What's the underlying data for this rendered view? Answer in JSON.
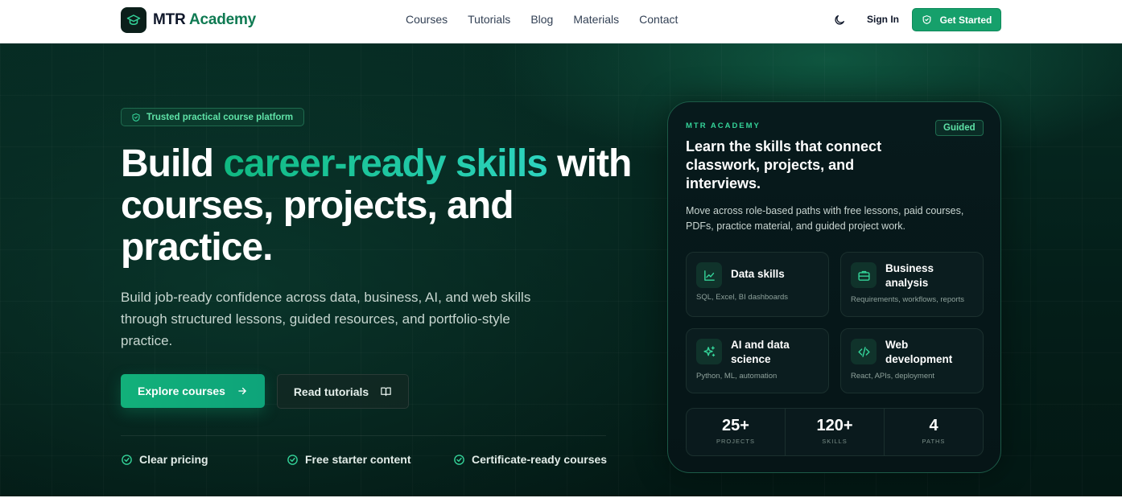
{
  "nav": {
    "brand_left": "MTR",
    "brand_right": "Academy",
    "links": [
      "Courses",
      "Tutorials",
      "Blog",
      "Materials",
      "Contact"
    ],
    "theme_icon": "moon-icon",
    "signin": "Sign In",
    "cta": "Get Started"
  },
  "hero": {
    "badge": "Trusted practical course platform",
    "headline_start": "Build ",
    "headline_accent": "career-ready skills",
    "headline_end": " with courses, projects, and practice.",
    "subtext": "Build job-ready confidence across data, business, AI, and web skills through structured lessons, guided resources, and portfolio-style practice.",
    "primary_cta": "Explore courses",
    "secondary_cta": "Read tutorials",
    "checks": [
      "Clear pricing",
      "Free starter content",
      "Certificate-ready courses"
    ]
  },
  "card": {
    "eyebrow": "MTR ACADEMY",
    "pill": "Guided",
    "title": "Learn the skills that connect classwork, projects, and interviews.",
    "description": "Move across role-based paths with free lessons, paid courses, PDFs, practice material, and guided project work.",
    "skills": [
      {
        "name": "Data skills",
        "meta": "SQL, Excel, BI dashboards",
        "icon": "chart-icon"
      },
      {
        "name": "Business analysis",
        "meta": "Requirements, workflows, reports",
        "icon": "briefcase-icon"
      },
      {
        "name": "AI and data science",
        "meta": "Python, ML, automation",
        "icon": "sparkles-icon"
      },
      {
        "name": "Web development",
        "meta": "React, APIs, deployment",
        "icon": "code-icon"
      }
    ],
    "stats": [
      {
        "value": "25+",
        "label": "PROJECTS"
      },
      {
        "value": "120+",
        "label": "SKILLS"
      },
      {
        "value": "4",
        "label": "PATHS"
      }
    ]
  },
  "colors": {
    "accent": "#16a06b",
    "accent_text": "#34d399",
    "hero_bg": "#041e19"
  }
}
